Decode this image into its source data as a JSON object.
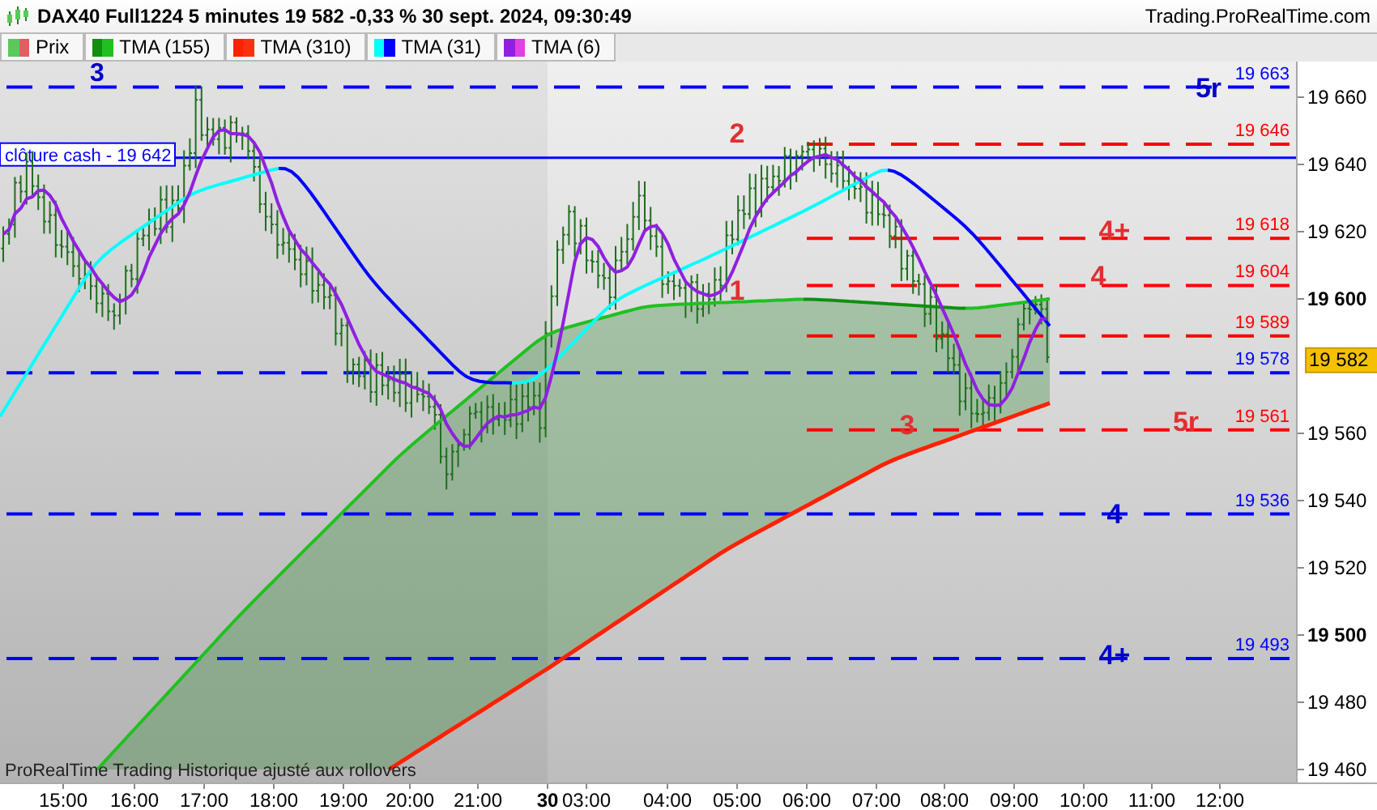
{
  "header": {
    "title": "DAX40 Full1224 5 minutes 19 582 -0,33 % 30 sept. 2024, 09:30:49",
    "site": "Trading.ProRealTime.com"
  },
  "legend": [
    {
      "label": "Prix",
      "color": "#5cc85c"
    },
    {
      "label": "TMA (155)",
      "color": "#109010"
    },
    {
      "label": "TMA (310)",
      "color": "#ff2000"
    },
    {
      "label": "TMA (31)",
      "color": "#00ffff"
    },
    {
      "label": "TMA (6)",
      "color": "#9020e0"
    }
  ],
  "chart": {
    "levels": [
      {
        "label": "19 663",
        "color": "#0000ff",
        "kind": "full"
      },
      {
        "label": "19 646",
        "color": "#ff0000",
        "kind": "partial"
      },
      {
        "label": "clôture cash -  19 642",
        "color": "#0000ff",
        "kind": "close"
      },
      {
        "label": "19 618",
        "color": "#ff0000",
        "kind": "partial"
      },
      {
        "label": "19 604",
        "color": "#ff0000",
        "kind": "partial"
      },
      {
        "label": "19 589",
        "color": "#ff0000",
        "kind": "partial"
      },
      {
        "label": "19 578",
        "color": "#0000ff",
        "kind": "full"
      },
      {
        "label": "19 561",
        "color": "#ff0000",
        "kind": "partial"
      },
      {
        "label": "19 536",
        "color": "#0000ff",
        "kind": "full"
      },
      {
        "label": "19 493",
        "color": "#0000ff",
        "kind": "full"
      }
    ],
    "annotations": [
      {
        "text": "3",
        "color": "#0000cc"
      },
      {
        "text": "2",
        "color": "#e03030"
      },
      {
        "text": "1",
        "color": "#e03030"
      },
      {
        "text": "3",
        "color": "#e03030"
      },
      {
        "text": "4+",
        "color": "#e03030"
      },
      {
        "text": "4",
        "color": "#e03030"
      },
      {
        "text": "5r",
        "color": "#e03030"
      },
      {
        "text": "5r",
        "color": "#0000cc"
      },
      {
        "text": "4",
        "color": "#0000cc"
      },
      {
        "text": "4+",
        "color": "#0000cc"
      }
    ],
    "footnote": "ProRealTime Trading  Historique ajusté aux rollovers",
    "price_axis": [
      {
        "label": "19 660",
        "bold": false
      },
      {
        "label": "19 640",
        "bold": false
      },
      {
        "label": "19 620",
        "bold": false
      },
      {
        "label": "19 600",
        "bold": true
      },
      {
        "label": "19 560",
        "bold": false
      },
      {
        "label": "19 540",
        "bold": false
      },
      {
        "label": "19 520",
        "bold": false
      },
      {
        "label": "19 500",
        "bold": true
      },
      {
        "label": "19 480",
        "bold": false
      },
      {
        "label": "19 460",
        "bold": false
      }
    ],
    "current_price": "19 582",
    "time_axis": [
      {
        "label": "15:00",
        "bold": false
      },
      {
        "label": "16:00",
        "bold": false
      },
      {
        "label": "17:00",
        "bold": false
      },
      {
        "label": "18:00",
        "bold": false
      },
      {
        "label": "19:00",
        "bold": false
      },
      {
        "label": "20:00",
        "bold": false
      },
      {
        "label": "21:00",
        "bold": false
      },
      {
        "label": "30",
        "bold": true
      },
      {
        "label": "03:00",
        "bold": false
      },
      {
        "label": "04:00",
        "bold": false
      },
      {
        "label": "05:00",
        "bold": false
      },
      {
        "label": "06:00",
        "bold": false
      },
      {
        "label": "07:00",
        "bold": false
      },
      {
        "label": "08:00",
        "bold": false
      },
      {
        "label": "09:00",
        "bold": false
      },
      {
        "label": "10:00",
        "bold": false
      },
      {
        "label": "11:00",
        "bold": false
      },
      {
        "label": "12:00",
        "bold": false
      }
    ]
  }
}
